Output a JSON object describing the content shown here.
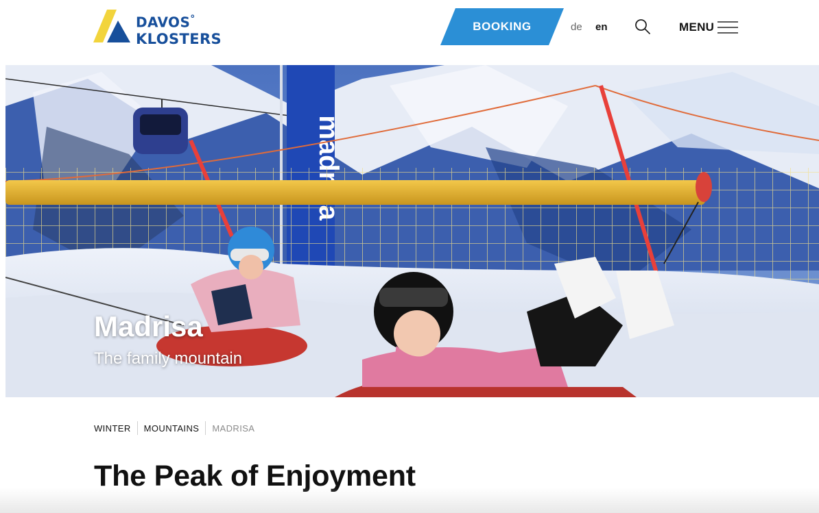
{
  "header": {
    "logo": {
      "line1": "DAVOS",
      "line1_mark": "°",
      "line2": "KLOSTERS"
    },
    "booking_label": "BOOKING",
    "languages": [
      {
        "code": "de",
        "active": false
      },
      {
        "code": "en",
        "active": true
      }
    ],
    "search_icon": "search-icon",
    "menu_label": "MENU",
    "menu_icon": "hamburger-icon"
  },
  "hero": {
    "title": "Madrisa",
    "subtitle": "The family mountain",
    "banner_text": "madrisa"
  },
  "breadcrumb": [
    {
      "label": "WINTER",
      "current": false
    },
    {
      "label": "MOUNTAINS",
      "current": false
    },
    {
      "label": "MADRISA",
      "current": true
    }
  ],
  "page": {
    "title": "The Peak of Enjoyment"
  },
  "colors": {
    "brand_blue": "#174f9b",
    "brand_yellow": "#f2d43c",
    "booking_blue": "#2b8fd6",
    "text": "#111111",
    "muted": "#8a8a8a"
  }
}
